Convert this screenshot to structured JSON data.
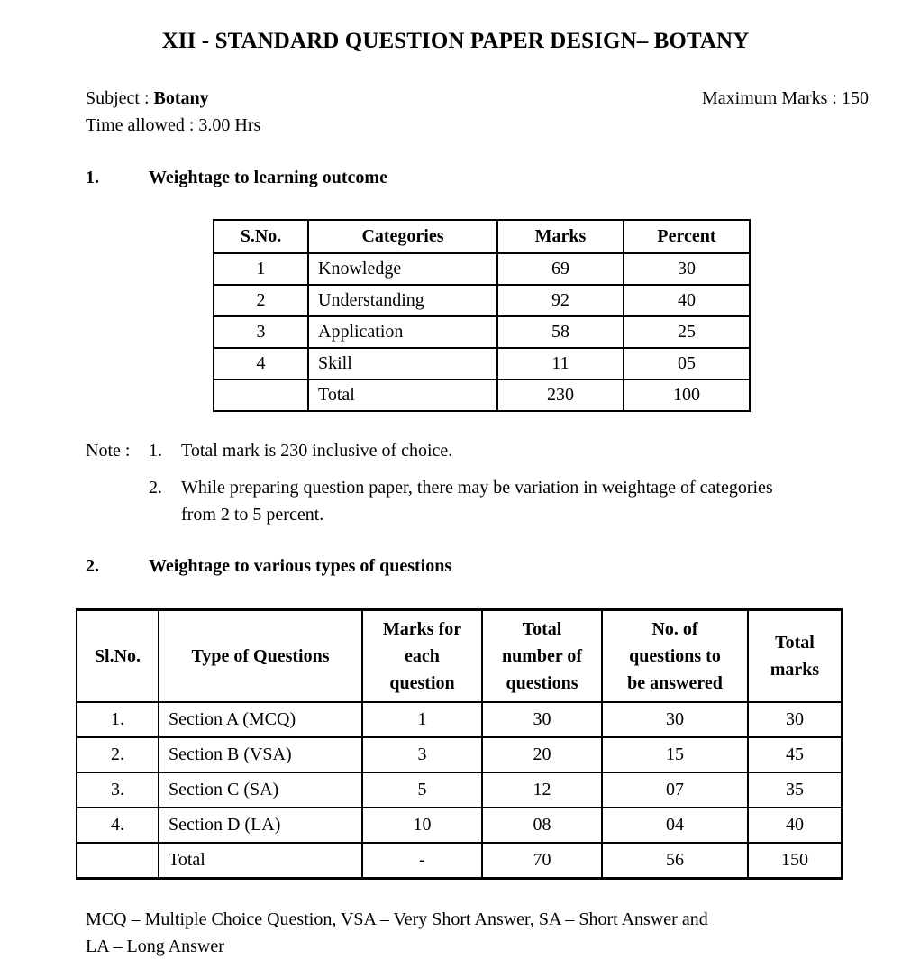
{
  "document": {
    "title": "XII - STANDARD QUESTION PAPER DESIGN–  BOTANY",
    "subject_label": "Subject : ",
    "subject_value": "Botany",
    "max_marks": "Maximum Marks : 150",
    "time_allowed": "Time allowed : 3.00 Hrs"
  },
  "section1": {
    "number": "1.",
    "heading": "Weightage to learning outcome",
    "table": {
      "headers": [
        "S.No.",
        "Categories",
        "Marks",
        "Percent"
      ],
      "rows": [
        [
          "1",
          "Knowledge",
          "69",
          "30"
        ],
        [
          "2",
          "Understanding",
          "92",
          "40"
        ],
        [
          "3",
          "Application",
          "58",
          "25"
        ],
        [
          "4",
          "Skill",
          "11",
          "05"
        ],
        [
          "",
          "Total",
          "230",
          "100"
        ]
      ]
    }
  },
  "notes": {
    "label": "Note :",
    "items": [
      {
        "number": "1.",
        "line1": "Total mark is 230 inclusive of choice.",
        "line2": ""
      },
      {
        "number": "2.",
        "line1": "While preparing question paper, there may be variation in weightage of categories",
        "line2": "from 2 to 5 percent."
      }
    ]
  },
  "section2": {
    "number": "2.",
    "heading": "Weightage to various types of questions",
    "table": {
      "headers": [
        [
          "Sl.No."
        ],
        [
          "Type of Questions"
        ],
        [
          "Marks for",
          "each",
          "question"
        ],
        [
          "Total",
          "number of",
          "questions"
        ],
        [
          "No. of",
          "questions to",
          "be answered"
        ],
        [
          "Total",
          "marks"
        ]
      ],
      "rows": [
        [
          "1.",
          "Section A (MCQ)",
          "1",
          "30",
          "30",
          "30"
        ],
        [
          "2.",
          "Section B (VSA)",
          "3",
          "20",
          "15",
          "45"
        ],
        [
          "3.",
          "Section C (SA)",
          "5",
          "12",
          "07",
          "35"
        ],
        [
          "4.",
          "Section D (LA)",
          "10",
          "08",
          "04",
          "40"
        ],
        [
          "",
          "Total",
          "-",
          "70",
          "56",
          "150"
        ]
      ]
    }
  },
  "footer": {
    "line1": "MCQ – Multiple Choice Question, VSA – Very Short Answer, SA – Short Answer and",
    "line2": "LA – Long Answer"
  }
}
